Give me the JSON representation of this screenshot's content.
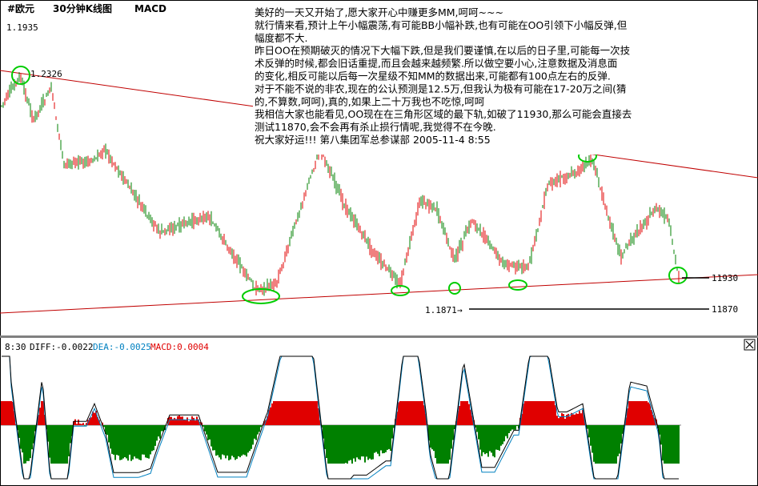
{
  "window": {
    "symbol": "#欧元",
    "period": "30分钟K线图",
    "indicator_tab": "MACD"
  },
  "price_pane": {
    "top_price_label": "1.1935",
    "high_marker_label": "1.2326",
    "low_marker_label": "1.1871",
    "level_labels": [
      "11930",
      "11870"
    ]
  },
  "macd_pane": {
    "label_prefix": "8:30",
    "diff_text": "DIFF:-0.0022",
    "dea_text": "DEA:-0.0025",
    "macd_text": "MACD:0.0004",
    "colors": {
      "diff": "#000000",
      "dea": "#0080c0",
      "macd": "#e00000"
    }
  },
  "annotation": {
    "lines": [
      "美好的一天又开始了,愿大家开心中赚更多MM,呵呵~~~",
      "就行情来看,预计上午小幅震荡,有可能BB小幅补跌,也有可能在OO引领下小幅反弹,但",
      "幅度都不大.",
      "昨日OO在预期破灭的情况下大幅下跌,但是我们要谨慎,在以后的日子里,可能每一次技",
      "术反弹的时候,都会旧话重提,而且会越来越频繁.所以做空要小心,注意数据及消息面",
      "的变化,相反可能以后每一次星级不知MM的数据出来,可能都有100点左右的反弹.",
      "对于不能不说的非农,现在的公认预测是12.5万,但我认为极有可能在17-20万之间(猜",
      "的,不算数,呵呵),真的,如果上二十万我也不吃惊,呵呵",
      "我相信大家也能看见,OO现在在三角形区域的最下轨,如破了11930,那么可能会直接去",
      "测试11870,会不会再有杀止损行情呢,我觉得不在今晚.",
      "祝大家好运!!!              第八集团军总参谋部  2005-11-4  8:55"
    ]
  },
  "chart_data": [
    {
      "type": "candlestick",
      "title": "30分钟K线图",
      "symbol": "#欧元",
      "ylim": [
        1.1855,
        1.1935
      ],
      "marked_prices": [
        {
          "label": "1.2326",
          "value": 1.2326
        },
        {
          "label": "1.1871",
          "value": 1.1871
        }
      ],
      "levels": [
        {
          "label": "11930",
          "value": 1.193
        },
        {
          "label": "11870",
          "value": 1.187
        }
      ],
      "lines": [
        "descending resistance trendline",
        "ascending support trendline"
      ],
      "circled_touches": 7,
      "colors": {
        "up": "#e00000",
        "down": "#008000",
        "trendline": "#c00000"
      }
    },
    {
      "type": "bar",
      "title": "MACD",
      "series": [
        {
          "name": "DIFF",
          "last_value": -0.0022
        },
        {
          "name": "DEA",
          "last_value": -0.0025
        },
        {
          "name": "MACD",
          "last_value": 0.0004
        }
      ]
    }
  ]
}
